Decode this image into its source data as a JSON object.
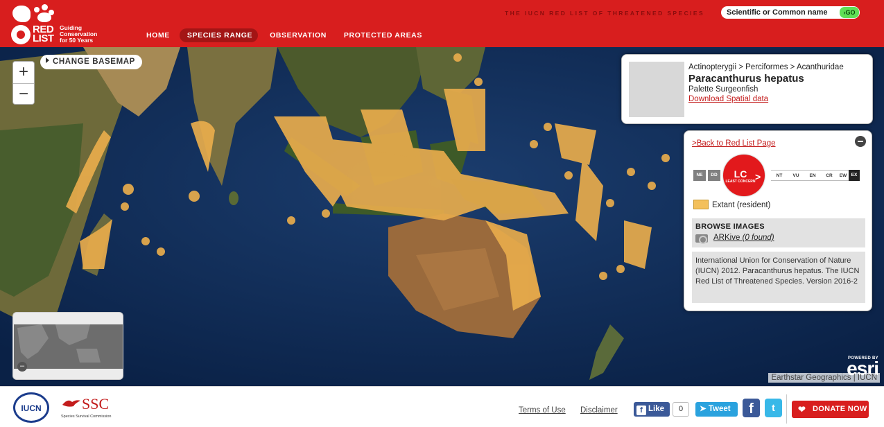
{
  "header": {
    "logo_text": "RED LIST",
    "logo_tagline": "Guiding Conservation for 50 Years",
    "site_title": "THE IUCN RED LIST OF THREATENED SPECIES",
    "nav": [
      {
        "label": "HOME"
      },
      {
        "label": "SPECIES RANGE"
      },
      {
        "label": "OBSERVATION"
      },
      {
        "label": "PROTECTED AREAS"
      }
    ],
    "search_placeholder": "Scientific or Common name",
    "search_button": "GO",
    "brand_color": "#d81e1e"
  },
  "map": {
    "zoom_in": "+",
    "zoom_out": "−",
    "change_basemap": "CHANGE BASEMAP",
    "overview_toggle": "–",
    "esri_powered": "POWERED BY",
    "esri_brand": "esri",
    "attribution": "Earthstar Geographics | IUCN",
    "range_color": "#f3c05b"
  },
  "species": {
    "taxonomy": "Actinopterygii > Perciformes > Acanthuridae",
    "scientific_name": "Paracanthurus hepatus",
    "common_name": "Palette Surgeonfish",
    "download_link": "Download Spatial data"
  },
  "panel": {
    "back_link": ">Back to Red List Page",
    "categories_left": [
      "NE",
      "DD"
    ],
    "categories_right": [
      "NT",
      "VU",
      "EN",
      "CR",
      "EW",
      "EX"
    ],
    "current_code": "LC",
    "current_name": "LEAST CONCERN",
    "arrow": ">",
    "legend_label": "Extant (resident)",
    "browse_title": "BROWSE IMAGES",
    "arkive_label": "ARKive",
    "arkive_count": "(0 found)",
    "citation": "International Union for Conservation of Nature (IUCN) 2012. Paracanthurus hepatus. The IUCN Red List of Threatened Species. Version 2016-2"
  },
  "footer": {
    "iucn_logo": "IUCN",
    "ssc_logo": "SSC",
    "ssc_sub": "Species Survival Commission",
    "terms": "Terms of Use",
    "disclaimer": "Disclaimer",
    "like_label": "Like",
    "like_count": "0",
    "tweet_label": "Tweet",
    "fb_icon": "f",
    "tw_icon": "t",
    "donate_label": "DONATE NOW"
  }
}
